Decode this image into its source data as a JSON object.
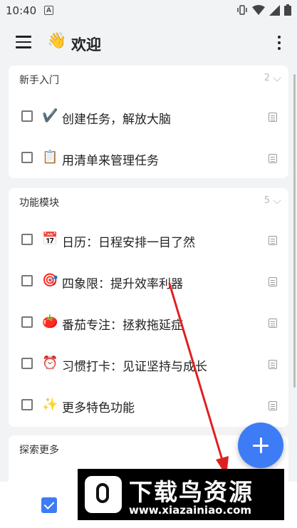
{
  "status_bar": {
    "time": "10:40",
    "notification_icon": "A"
  },
  "app_bar": {
    "emoji": "👋",
    "title": "欢迎"
  },
  "sections": [
    {
      "title": "新手入门",
      "count": "2",
      "items": [
        {
          "emoji": "✔️",
          "label": "创建任务，解放大脑"
        },
        {
          "emoji": "📋",
          "label": "用清单来管理任务"
        }
      ]
    },
    {
      "title": "功能模块",
      "count": "5",
      "items": [
        {
          "emoji": "📅",
          "label": "日历：日程安排一目了然"
        },
        {
          "emoji": "🎯",
          "label": "四象限：提升效率利器"
        },
        {
          "emoji": "🍅",
          "label": "番茄专注：拯救拖延症"
        },
        {
          "emoji": "⏰",
          "label": "习惯打卡：见证坚持与成长"
        },
        {
          "emoji": "✨",
          "label": "更多特色功能"
        }
      ]
    },
    {
      "title": "探索更多",
      "count": "",
      "items": []
    }
  ],
  "watermark": {
    "title": "下载鸟资源",
    "url": "www.xiazainiao.com"
  },
  "colors": {
    "accent": "#3d7cf5",
    "annotation_arrow": "#e02020"
  }
}
